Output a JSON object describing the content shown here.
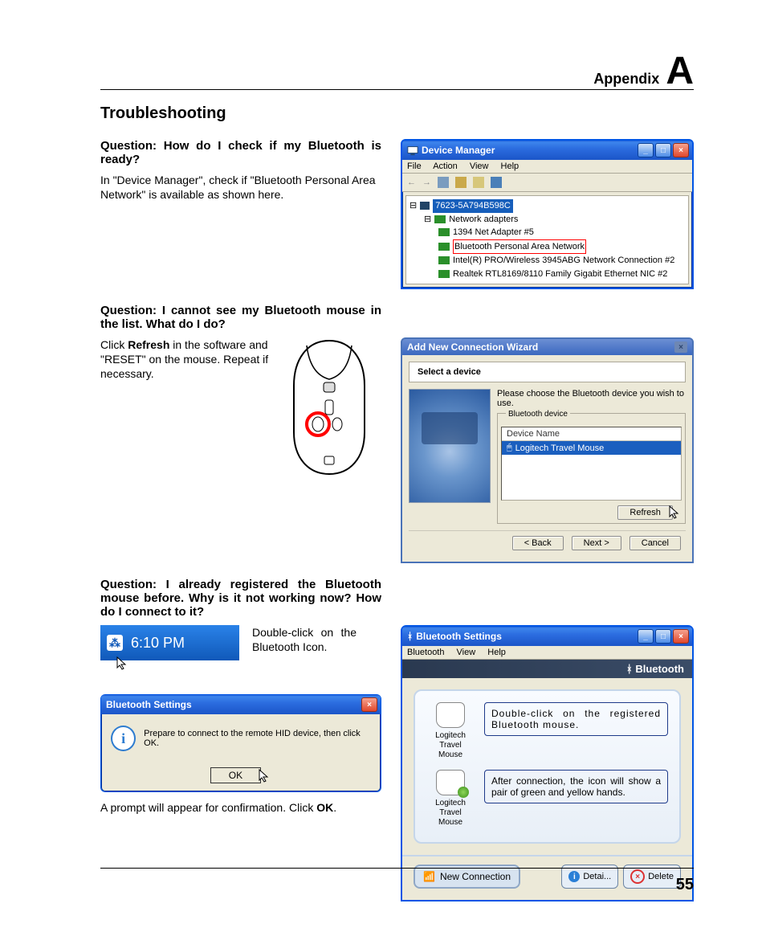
{
  "header": {
    "appendix_label": "Appendix",
    "appendix_letter": "A"
  },
  "section_title": "Troubleshooting",
  "page_number": "55",
  "q1": {
    "question": "Question: How do I check if my Bluetooth is ready?",
    "answer": "In \"Device Manager\", check if \"Bluetooth Personal Area Network\" is available as shown here."
  },
  "devmgr": {
    "title": "Device Manager",
    "menus": [
      "File",
      "Action",
      "View",
      "Help"
    ],
    "computer": "7623-5A794B598C",
    "adapters_label": "Network adapters",
    "items": [
      "1394 Net Adapter #5",
      "Bluetooth Personal Area Network",
      "Intel(R) PRO/Wireless 3945ABG Network Connection #2",
      "Realtek RTL8169/8110 Family Gigabit Ethernet NIC #2"
    ]
  },
  "q2": {
    "question": "Question: I cannot see my Bluetooth mouse in the list. What do I do?",
    "answer_prefix": "Click ",
    "answer_bold": "Refresh",
    "answer_suffix": " in the software and \"RESET\" on the mouse. Repeat if necessary."
  },
  "wizard": {
    "title": "Add New Connection Wizard",
    "step_header": "Select a device",
    "instruction": "Please choose the Bluetooth device you wish to use.",
    "fieldset_label": "Bluetooth device",
    "list_header": "Device Name",
    "device": "Logitech Travel Mouse",
    "refresh_btn": "Refresh",
    "back_btn": "< Back",
    "next_btn": "Next >",
    "cancel_btn": "Cancel"
  },
  "q3": {
    "question": "Question: I already registered the Bluetooth mouse before. Why is it not working now? How do I connect to it?",
    "clock_time": "6:10 PM",
    "tip": "Double-click on the Bluetooth Icon.",
    "dialog_title": "Bluetooth Settings",
    "dialog_msg": "Prepare to connect to the remote HID device, then click OK.",
    "ok_label": "OK",
    "caption_prefix": "A prompt will appear for confirmation. Click ",
    "caption_bold": "OK",
    "caption_suffix": "."
  },
  "bts": {
    "title": "Bluetooth Settings",
    "menus": [
      "Bluetooth",
      "View",
      "Help"
    ],
    "brand": "Bluetooth",
    "device_label": "Logitech Travel Mouse",
    "note1": "Double-click on the registered Bluetooth mouse.",
    "note2": "After connection, the icon will show a pair of green and yellow hands.",
    "new_conn": "New Connection",
    "detail_btn": "Detai...",
    "delete_btn": "Delete"
  }
}
